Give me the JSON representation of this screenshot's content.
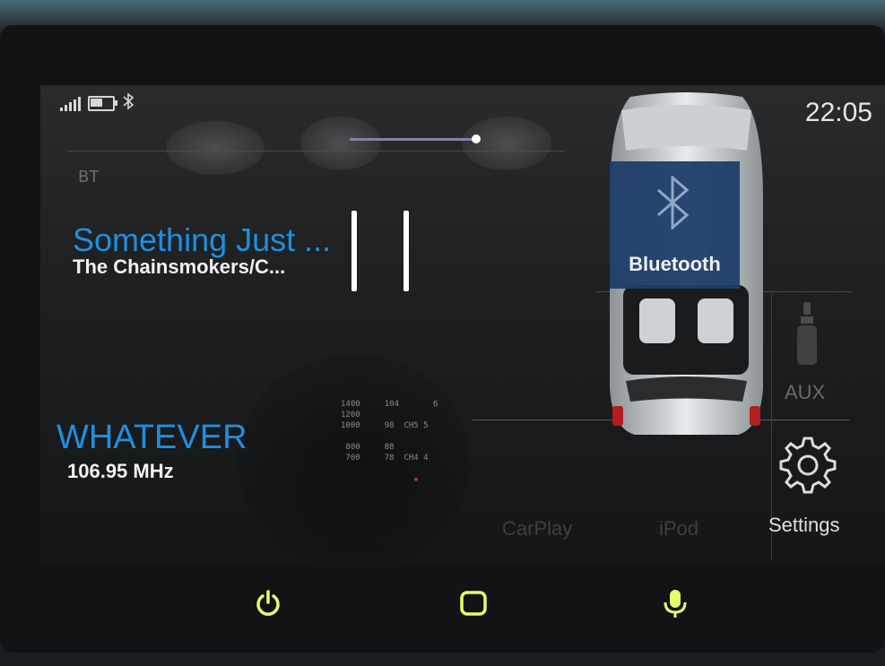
{
  "status": {
    "signal_icon": "signal-bars-icon",
    "battery_icon": "battery-icon",
    "bluetooth_icon": "bluetooth-icon",
    "time": "22:05"
  },
  "media": {
    "source_label": "BT",
    "song_title": "Something Just ...",
    "artist": "The Chainsmokers/C...",
    "progress": 0.95,
    "pause_icon": "pause-icon"
  },
  "radio": {
    "station": "WHATEVER",
    "frequency": "106.95 MHz"
  },
  "tiles": {
    "bluetooth_label": "Bluetooth",
    "aux_label": "AUX",
    "settings_label": "Settings",
    "carplay_label": "CarPlay",
    "ipod_label": "iPod"
  },
  "hardware_buttons": {
    "power_icon": "power-icon",
    "home_icon": "home-icon",
    "voice_icon": "microphone-icon"
  },
  "colors": {
    "accent_blue": "#1f8fe0",
    "hw_button_glow": "#e4ff6a",
    "tile_blue": "#1d3e6a"
  }
}
